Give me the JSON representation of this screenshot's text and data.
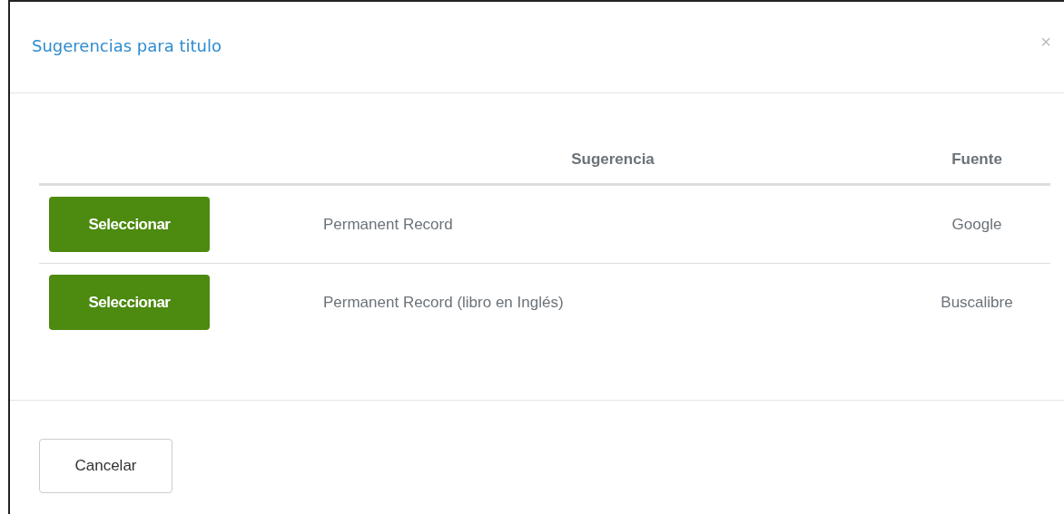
{
  "dialog": {
    "title": "Sugerencias para titulo",
    "close": "×"
  },
  "table": {
    "columns": [
      "Sugerencia",
      "Fuente"
    ],
    "rows": [
      {
        "button": "Seleccionar",
        "suggestion": "Permanent Record",
        "source": "Google"
      },
      {
        "button": "Seleccionar",
        "suggestion": "Permanent Record (libro en Inglés)",
        "source": "Buscalibre"
      }
    ]
  },
  "footer": {
    "cancel": "Cancelar"
  }
}
